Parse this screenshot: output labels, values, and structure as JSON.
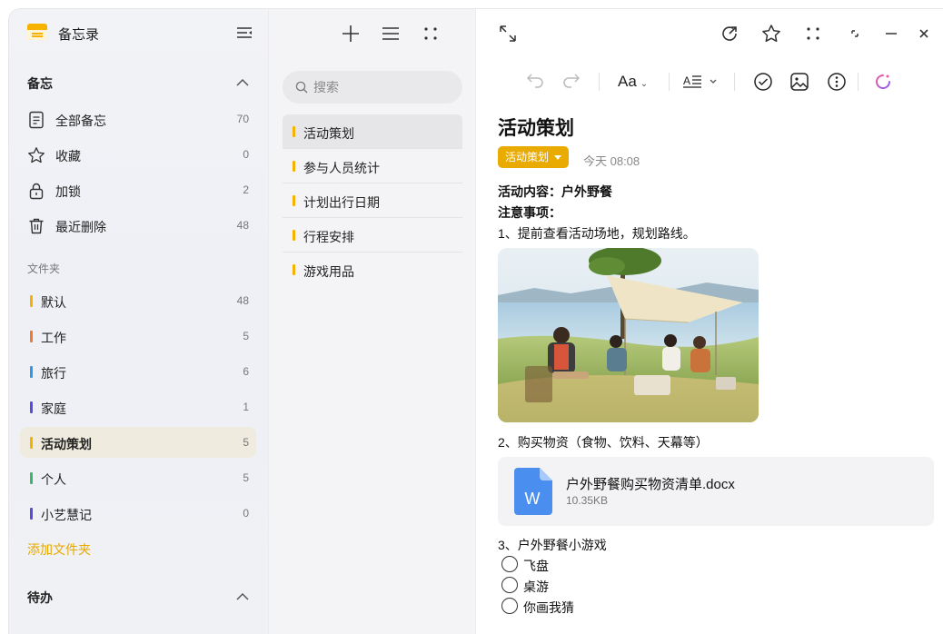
{
  "app": {
    "title": "备忘录"
  },
  "sidebar": {
    "memo_section": "备忘",
    "items": [
      {
        "label": "全部备忘",
        "count": "70",
        "icon": "document-icon"
      },
      {
        "label": "收藏",
        "count": "0",
        "icon": "star-icon"
      },
      {
        "label": "加锁",
        "count": "2",
        "icon": "lock-icon"
      },
      {
        "label": "最近删除",
        "count": "48",
        "icon": "trash-icon"
      }
    ],
    "folder_section": "文件夹",
    "folders": [
      {
        "label": "默认",
        "count": "48",
        "color": "#f5b300"
      },
      {
        "label": "工作",
        "count": "5",
        "color": "#f07a2e"
      },
      {
        "label": "旅行",
        "count": "6",
        "color": "#2e9ae8"
      },
      {
        "label": "家庭",
        "count": "1",
        "color": "#5a4be0"
      },
      {
        "label": "活动策划",
        "count": "5",
        "color": "#f5b300"
      },
      {
        "label": "个人",
        "count": "5",
        "color": "#3ab86a"
      },
      {
        "label": "小艺慧记",
        "count": "0",
        "color": "#5a4be0"
      }
    ],
    "add_folder": "添加文件夹",
    "todo_section": "待办"
  },
  "list": {
    "search_placeholder": "搜索",
    "notes": [
      "活动策划",
      "参与人员统计",
      "计划出行日期",
      "行程安排",
      "游戏用品"
    ]
  },
  "editor": {
    "title": "活动策划",
    "tag": "活动策划",
    "time": "今天 08:08",
    "content_label": "活动内容：户外野餐",
    "notes_label": "注意事项：",
    "step1": "1、提前查看活动场地，规划路线。",
    "step2": "2、购买物资（食物、饮料、天幕等）",
    "attachment": {
      "name": "户外野餐购买物资清单.docx",
      "size": "10.35KB",
      "icon_letter": "W"
    },
    "step3": "3、户外野餐小游戏",
    "checklist": [
      "飞盘",
      "桌游",
      "你画我猜"
    ],
    "font_button": "Aa"
  },
  "colors": {
    "accent": "#f5b300",
    "tag": "#e9ab00",
    "word_blue": "#4a8ff0"
  }
}
